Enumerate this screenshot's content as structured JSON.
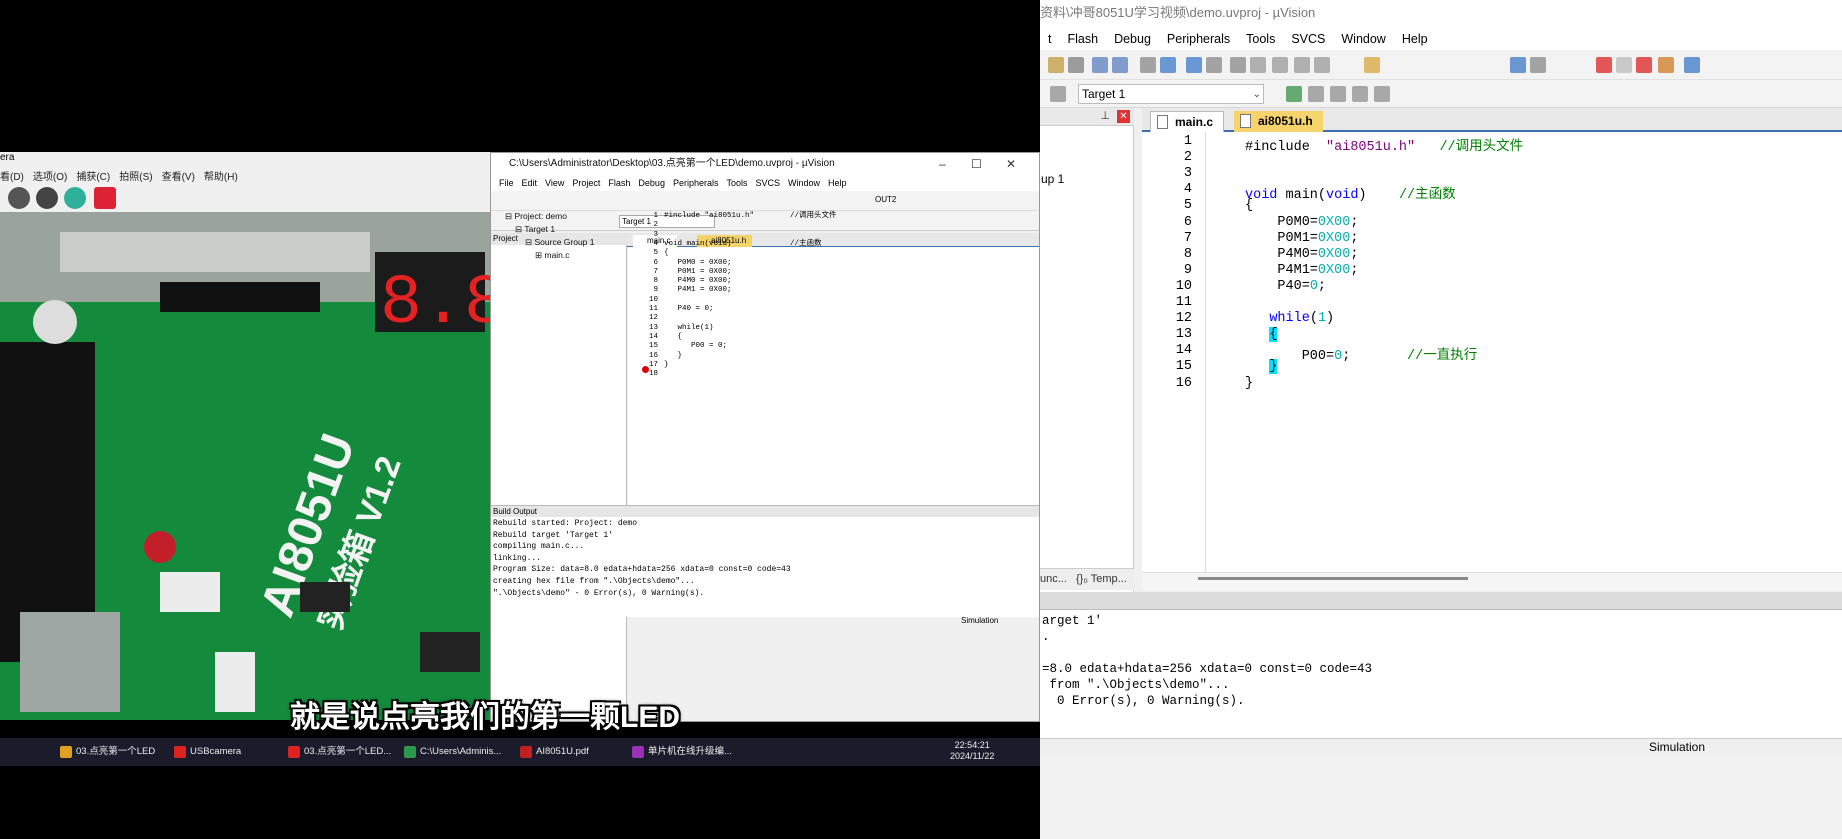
{
  "right_window": {
    "title": "资料\\冲哥8051U学习视频\\demo.uvproj - µVision",
    "menu": [
      "t",
      "Flash",
      "Debug",
      "Peripherals",
      "Tools",
      "SVCS",
      "Window",
      "Help"
    ],
    "target": "Target 1",
    "tabs": [
      "main.c",
      "ai8051u.h"
    ],
    "project_fragment": "up 1",
    "project_tabs": [
      "unc...",
      "{}₀ Temp..."
    ],
    "code": [
      {
        "n": "1",
        "parts": [
          [
            "pp",
            "#include"
          ],
          [
            "sp",
            "  "
          ],
          [
            "str",
            "\"ai8051u.h\""
          ],
          [
            "sp",
            "   "
          ],
          [
            "cm",
            "//调用头文件"
          ]
        ]
      },
      {
        "n": "2",
        "parts": []
      },
      {
        "n": "3",
        "parts": []
      },
      {
        "n": "4",
        "parts": [
          [
            "kw",
            "void"
          ],
          [
            "sp",
            " main("
          ],
          [
            "kw",
            "void"
          ],
          [
            "sp",
            ")    "
          ],
          [
            "cm",
            "//主函数"
          ]
        ]
      },
      {
        "n": "5",
        "parts": [
          [
            "sp",
            "{"
          ]
        ]
      },
      {
        "n": "6",
        "parts": [
          [
            "sp",
            "    P0M0="
          ],
          [
            "num",
            "0X00"
          ],
          [
            "sp",
            ";"
          ]
        ]
      },
      {
        "n": "7",
        "parts": [
          [
            "sp",
            "    P0M1="
          ],
          [
            "num",
            "0X00"
          ],
          [
            "sp",
            ";"
          ]
        ]
      },
      {
        "n": "8",
        "parts": [
          [
            "sp",
            "    P4M0="
          ],
          [
            "num",
            "0X00"
          ],
          [
            "sp",
            ";"
          ]
        ]
      },
      {
        "n": "9",
        "parts": [
          [
            "sp",
            "    P4M1="
          ],
          [
            "num",
            "0X00"
          ],
          [
            "sp",
            ";"
          ]
        ]
      },
      {
        "n": "10",
        "parts": [
          [
            "sp",
            "    P40="
          ],
          [
            "num",
            "0"
          ],
          [
            "sp",
            ";"
          ]
        ]
      },
      {
        "n": "11",
        "parts": []
      },
      {
        "n": "12",
        "parts": [
          [
            "sp",
            "   "
          ],
          [
            "kw",
            "while"
          ],
          [
            "sp",
            "("
          ],
          [
            "num",
            "1"
          ],
          [
            "sp",
            ")"
          ]
        ]
      },
      {
        "n": "13",
        "parts": [
          [
            "sp",
            "   "
          ],
          [
            "brk",
            "{"
          ]
        ]
      },
      {
        "n": "14",
        "parts": [
          [
            "sp",
            "       P00="
          ],
          [
            "num",
            "0"
          ],
          [
            "sp",
            ";       "
          ],
          [
            "cm",
            "//一直执行"
          ]
        ]
      },
      {
        "n": "15",
        "parts": [
          [
            "sp",
            "   "
          ],
          [
            "brk",
            "}"
          ]
        ]
      },
      {
        "n": "16",
        "parts": [
          [
            "sp",
            "}"
          ]
        ]
      }
    ],
    "output": [
      "arget 1'",
      ".",
      "",
      "=8.0 edata+hdata=256 xdata=0 const=0 code=43",
      " from \".\\Objects\\demo\"...",
      "  0 Error(s), 0 Warning(s)."
    ],
    "status": "Simulation"
  },
  "left_app": {
    "title_fragment": "era",
    "menu": [
      "看(D)",
      "选项(O)",
      "捕获(C)",
      "拍照(S)",
      "查看(V)",
      "帮助(H)"
    ]
  },
  "small_window": {
    "title": "C:\\Users\\Administrator\\Desktop\\03.点亮第一个LED\\demo.uvproj - µVision",
    "menu": [
      "File",
      "Edit",
      "View",
      "Project",
      "Flash",
      "Debug",
      "Peripherals",
      "Tools",
      "SVCS",
      "Window",
      "Help"
    ],
    "target": "Target 1",
    "toolbar_text": "OUT2",
    "project_header": "Project",
    "tree": [
      "Project: demo",
      "Target 1",
      "Source Group 1",
      "main.c"
    ],
    "tabs": [
      "main.c",
      "ai8051u.h"
    ],
    "code": [
      {
        "n": "1",
        "t": "#include \"ai8051u.h\"        //调用头文件"
      },
      {
        "n": "2",
        "t": ""
      },
      {
        "n": "3",
        "t": ""
      },
      {
        "n": "4",
        "t": "void main(void)             //主函数"
      },
      {
        "n": "5",
        "t": "{"
      },
      {
        "n": "6",
        "t": "   P0M0 = 0X00;"
      },
      {
        "n": "7",
        "t": "   P0M1 = 0X00;"
      },
      {
        "n": "8",
        "t": "   P4M0 = 0X00;"
      },
      {
        "n": "9",
        "t": "   P4M1 = 0X00;"
      },
      {
        "n": "10",
        "t": ""
      },
      {
        "n": "11",
        "t": "   P40 = 0;"
      },
      {
        "n": "12",
        "t": ""
      },
      {
        "n": "13",
        "t": "   while(1)"
      },
      {
        "n": "14",
        "t": "   {"
      },
      {
        "n": "15",
        "t": "      P00 = 0;"
      },
      {
        "n": "16",
        "t": "   }"
      },
      {
        "n": "17",
        "t": "}"
      },
      {
        "n": "18",
        "t": ""
      }
    ],
    "build_header": "Build Output",
    "build": [
      "Rebuild started: Project: demo",
      "Rebuild target 'Target 1'",
      "compiling main.c...",
      "linking...",
      "Program Size: data=8.0 edata+hdata=256 xdata=0 const=0 code=43",
      "creating hex file from \".\\Objects\\demo\"...",
      "\".\\Objects\\demo\" - 0 Error(s), 0 Warning(s)."
    ],
    "status": "Simulation"
  },
  "taskbar": {
    "items": [
      "03.点亮第一个LED",
      "USBcamera",
      "03.点亮第一个LED...",
      "C:\\Users\\Adminis...",
      "AI8051U.pdf",
      "单片机在线升级编..."
    ],
    "time": "22:54:21",
    "date": "2024/11/22"
  },
  "subtitle": "就是说点亮我们的第一颗LED",
  "colors": {
    "accent": "#3a6fb0",
    "keyword": "#0000ff",
    "comment": "#008000",
    "string": "#800080",
    "number": "#00b0b0"
  }
}
